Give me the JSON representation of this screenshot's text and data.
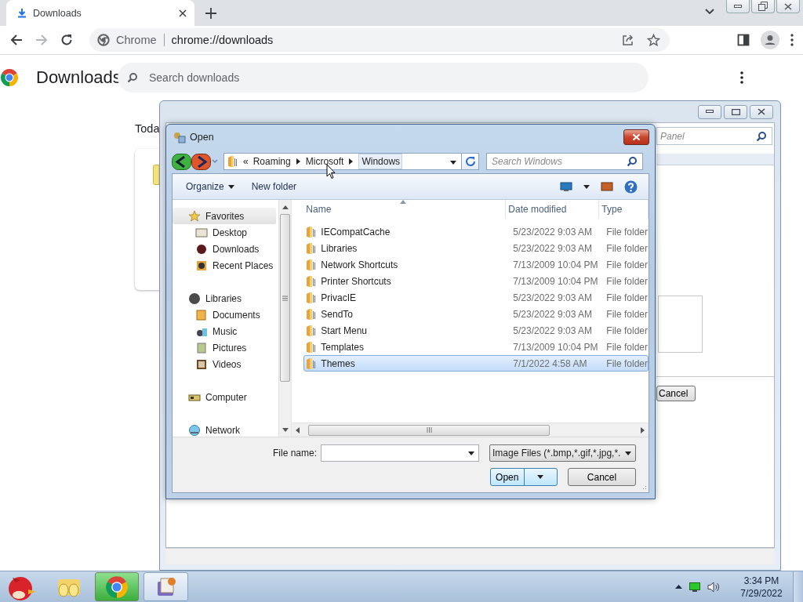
{
  "browser": {
    "tab": {
      "title": "Downloads"
    },
    "omnibox": {
      "site": "Chrome",
      "url": "chrome://downloads"
    }
  },
  "downloads_page": {
    "title": "Downloads",
    "search": {
      "placeholder": "Search downloads"
    },
    "date_heading": "Toda"
  },
  "back_window": {
    "search": {
      "placeholder": "Panel"
    },
    "cancel_button": "Cancel"
  },
  "open_dialog": {
    "title": "Open",
    "path_overflow": "«",
    "path": [
      {
        "label": "Roaming",
        "selected": false
      },
      {
        "label": "Microsoft",
        "selected": false
      },
      {
        "label": "Windows",
        "selected": true
      }
    ],
    "search": {
      "placeholder": "Search Windows"
    },
    "toolbar": [
      "Organize",
      "New folder"
    ],
    "nav": [
      {
        "label": "Favorites",
        "selected": true,
        "children": [
          {
            "label": "Desktop",
            "selected": false
          },
          {
            "label": "Downloads",
            "selected": false
          },
          {
            "label": "Recent Places",
            "selected": false
          }
        ]
      },
      {
        "label": "Libraries",
        "selected": false,
        "children": [
          {
            "label": "Documents",
            "selected": false
          },
          {
            "label": "Music",
            "selected": false
          },
          {
            "label": "Pictures",
            "selected": false
          },
          {
            "label": "Videos",
            "selected": false
          }
        ]
      },
      {
        "label": "Computer",
        "selected": false
      },
      {
        "label": "Network",
        "selected": false
      }
    ],
    "columns": [
      "Name",
      "Date modified",
      "Type"
    ],
    "rows": [
      {
        "name": "IECompatCache",
        "date": "5/23/2022 9:03 AM",
        "type": "File folder",
        "selected": false
      },
      {
        "name": "Libraries",
        "date": "5/23/2022 9:03 AM",
        "type": "File folder",
        "selected": false
      },
      {
        "name": "Network Shortcuts",
        "date": "7/13/2009 10:04 PM",
        "type": "File folder",
        "selected": false
      },
      {
        "name": "Printer Shortcuts",
        "date": "7/13/2009 10:04 PM",
        "type": "File folder",
        "selected": false
      },
      {
        "name": "PrivacIE",
        "date": "5/23/2022 9:03 AM",
        "type": "File folder",
        "selected": false
      },
      {
        "name": "SendTo",
        "date": "5/23/2022 9:03 AM",
        "type": "File folder",
        "selected": false
      },
      {
        "name": "Start Menu",
        "date": "5/23/2022 9:03 AM",
        "type": "File folder",
        "selected": false
      },
      {
        "name": "Templates",
        "date": "7/13/2009 10:04 PM",
        "type": "File folder",
        "selected": false
      },
      {
        "name": "Themes",
        "date": "7/1/2022 4:58 AM",
        "type": "File folder",
        "selected": true
      }
    ],
    "file_name": {
      "label": "File name:"
    },
    "file_type": "Image Files (*.bmp,*.gif,*.jpg,*.",
    "buttons": [
      "Open",
      "Cancel"
    ]
  },
  "taskbar": {
    "time": "3:34 PM",
    "date": "7/29/2022"
  }
}
